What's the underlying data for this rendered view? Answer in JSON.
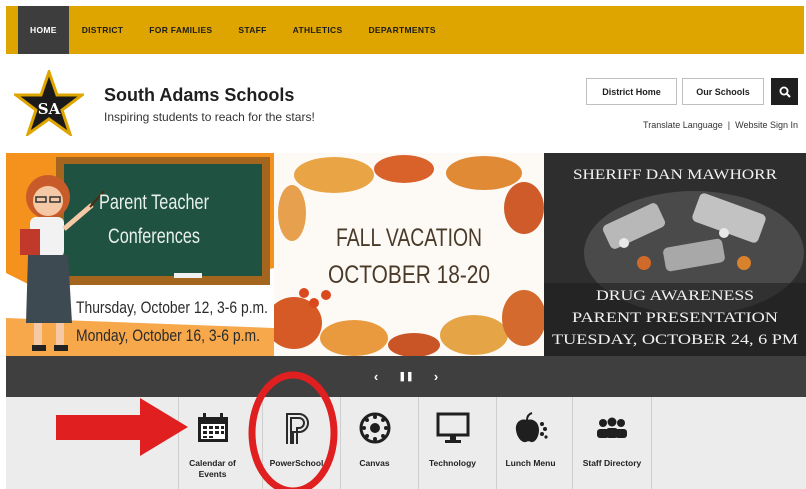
{
  "nav": {
    "items": [
      {
        "label": "HOME"
      },
      {
        "label": "DISTRICT"
      },
      {
        "label": "FOR FAMILIES"
      },
      {
        "label": "STAFF"
      },
      {
        "label": "ATHLETICS"
      },
      {
        "label": "DEPARTMENTS"
      }
    ]
  },
  "header": {
    "logo_text": "SA",
    "title": "South Adams Schools",
    "tagline": "Inspiring students to reach for the stars!",
    "district_home": "District Home",
    "our_schools": "Our Schools",
    "translate": "Translate Language",
    "separator": "|",
    "sign_in": "Website Sign In"
  },
  "banner": {
    "slide1": {
      "line1": "Parent Teacher",
      "line2": "Conferences",
      "date1": "Thursday, October 12, 3-6 p.m.",
      "date2": "Monday, October 16, 3-6 p.m."
    },
    "slide2": {
      "line1": "FALL VACATION",
      "line2": "OCTOBER 18-20"
    },
    "slide3": {
      "title": "SHERIFF DAN MAWHORR",
      "line1": "DRUG AWARENESS",
      "line2": "PARENT PRESENTATION",
      "line3": "TUESDAY, OCTOBER 24, 6 PM"
    },
    "controls": {
      "prev": "‹",
      "pause": "❚❚",
      "next": "›"
    }
  },
  "quicklinks": [
    {
      "label": "Calendar of Events",
      "icon": "calendar-icon"
    },
    {
      "label": "PowerSchool",
      "icon": "powerschool-icon"
    },
    {
      "label": "Canvas",
      "icon": "canvas-icon"
    },
    {
      "label": "Technology",
      "icon": "monitor-icon"
    },
    {
      "label": "Lunch Menu",
      "icon": "apple-icon"
    },
    {
      "label": "Staff Directory",
      "icon": "people-icon"
    }
  ],
  "colors": {
    "nav_bar": "#dea500",
    "nav_active": "#3d3d3d",
    "annotation_red": "#e02020"
  }
}
